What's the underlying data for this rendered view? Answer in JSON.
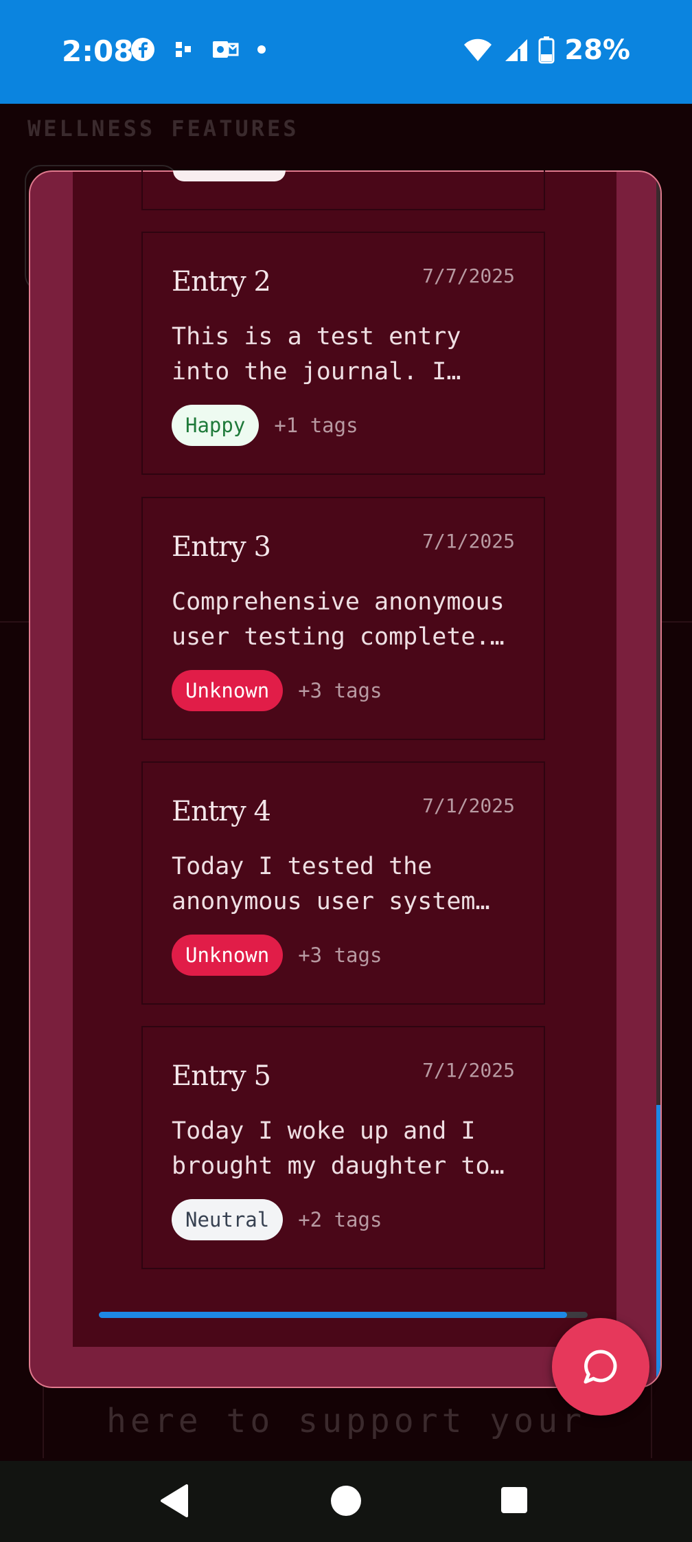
{
  "status_bar": {
    "time": "2:08",
    "battery": "28%",
    "icons_left": [
      "facebook-icon",
      "slack-icon",
      "outlook-icon",
      "dot-icon"
    ],
    "icons_right": [
      "wifi-icon",
      "signal-icon",
      "battery-icon"
    ]
  },
  "background": {
    "heading": "WELLNESS FEATURES",
    "support_text": "here to support your"
  },
  "entries": [
    {
      "title": "Entry 2",
      "date": "7/7/2025",
      "text": "This is a test entry into the journal. I…",
      "mood": "Happy",
      "more_tags": "+1 tags"
    },
    {
      "title": "Entry 3",
      "date": "7/1/2025",
      "text": "Comprehensive anonymous user testing complete.…",
      "mood": "Unknown",
      "more_tags": "+3 tags"
    },
    {
      "title": "Entry 4",
      "date": "7/1/2025",
      "text": "Today I tested the anonymous user system…",
      "mood": "Unknown",
      "more_tags": "+3 tags"
    },
    {
      "title": "Entry 5",
      "date": "7/1/2025",
      "text": "Today I woke up and I brought my daughter to…",
      "mood": "Neutral",
      "more_tags": "+2 tags"
    }
  ],
  "fab": {
    "icon": "chat-bubble-icon"
  },
  "colors": {
    "status_bar": "#0b84df",
    "modal_frame": "#7a1f3d",
    "modal_inner": "#4a0718",
    "accent_blue": "#1e88e5",
    "fab": "#e6385b",
    "pill_unknown": "#e11d48"
  }
}
